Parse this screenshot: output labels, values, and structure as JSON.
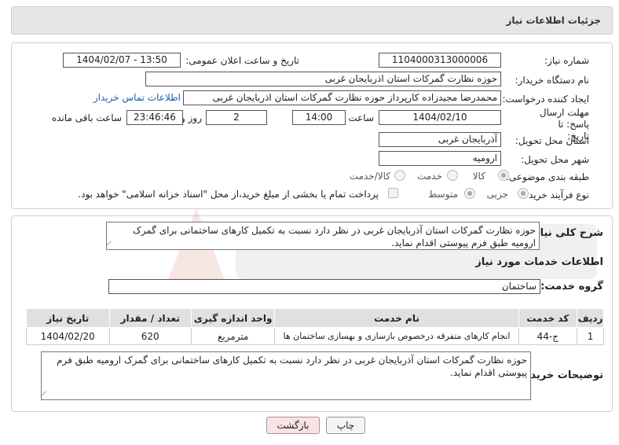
{
  "header": {
    "title": "جزئیات اطلاعات نیاز"
  },
  "form": {
    "need_number_label": "شماره نیاز:",
    "need_number": "1104000313000006",
    "announce_label": "تاریخ و ساعت اعلان عمومی:",
    "announce_value": "1404/02/07 - 13:50",
    "buyer_org_label": "نام دستگاه خریدار:",
    "buyer_org": "حوزه نظارت گمرکات استان اذربایجان غربی",
    "creator_label": "ایجاد کننده درخواست:",
    "creator": "محمدرضا مجیدزاده کارپرداز حوزه نظارت گمرکات استان اذربایجان غربی",
    "contact_link": "اطلاعات تماس خریدار",
    "deadline_label": "مهلت ارسال پاسخ: تا تاریخ:",
    "deadline_date": "1404/02/10",
    "time_label": "ساعت",
    "deadline_time": "14:00",
    "days_value": "2",
    "days_label": "روز و",
    "remaining_time": "23:46:46",
    "remaining_label": "ساعت باقی مانده",
    "province_label": "استان محل تحویل:",
    "province": "آذربایجان غربی",
    "city_label": "شهر محل تحویل:",
    "city": "ارومیه",
    "category_label": "طبقه بندی موضوعی:",
    "category_options": [
      "کالا",
      "خدمت",
      "کالا/خدمت"
    ],
    "process_label": "نوع فرآیند خرید :",
    "process_options": [
      "جزیی",
      "متوسط"
    ],
    "payment_note": "پرداخت تمام یا بخشی از مبلغ خرید،از محل \"اسناد خزانه اسلامی\" خواهد بود."
  },
  "summary": {
    "label": "شرح کلی نیاز:",
    "text": "حوزه نظارت گمرکات استان آذربایجان غربی در نظر دارد نسبت به تکمیل کارهای ساختمانی برای گمرک ارومیه طبق فرم پیوستی اقدام نماید."
  },
  "services": {
    "title": "اطلاعات خدمات مورد نیاز",
    "group_label": "گروه خدمت:",
    "group_value": "ساختمان",
    "columns": [
      "ردیف",
      "کد خدمت",
      "نام خدمت",
      "واحد اندازه گیری",
      "تعداد / مقدار",
      "تاریخ نیاز"
    ],
    "rows": [
      [
        "1",
        "ج-44",
        "انجام کارهای متفرقه درخصوص بازسازی و بهسازی ساختمان ها",
        "مترمربع",
        "620",
        "1404/02/20"
      ]
    ]
  },
  "buyer_notes": {
    "label": "توضیحات خریدار:",
    "text": "حوزه نظارت گمرکات استان آذربایجان غربی در نظر دارد نسبت به تکمیل کارهای ساختمانی برای گمرک ارومیه طبق فرم پیوستی اقدام نماید."
  },
  "buttons": {
    "print": "چاپ",
    "back": "بازگشت"
  },
  "colors": {
    "link": "#1a5fb4",
    "header_bg": "#e6e6e6",
    "back_button_bg": "#fbe3e3"
  }
}
